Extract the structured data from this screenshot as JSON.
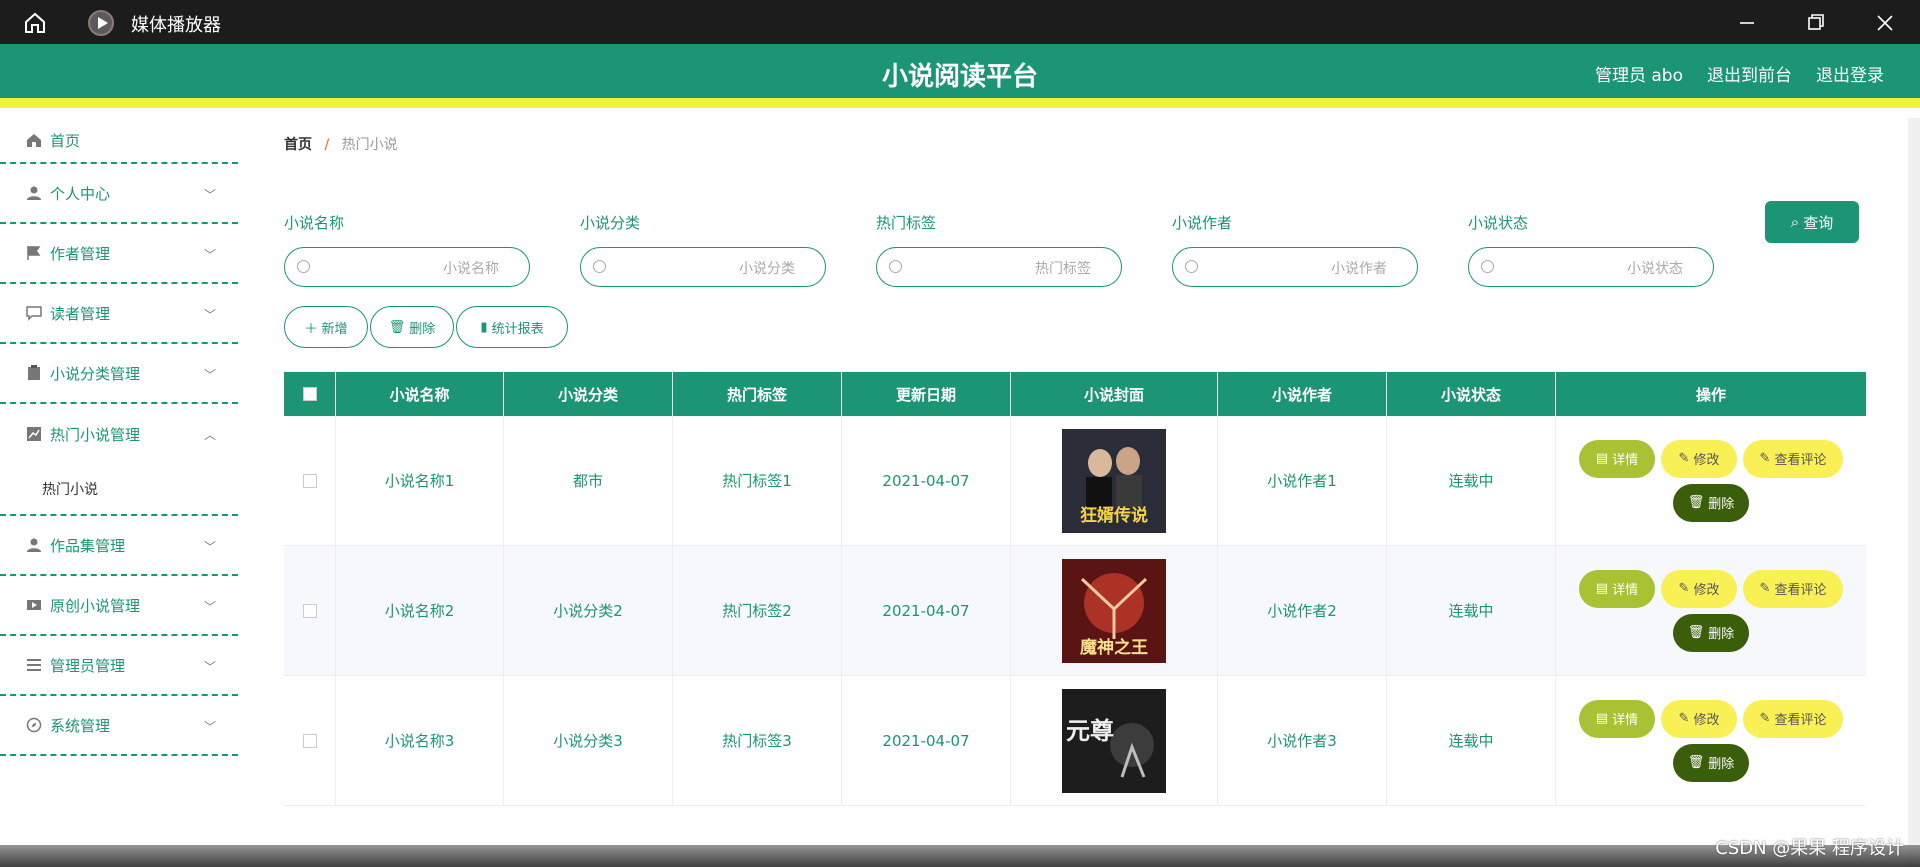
{
  "window": {
    "title": "媒体播放器"
  },
  "header": {
    "title": "小说阅读平台",
    "admin": "管理员 abo",
    "to_front": "退出到前台",
    "logout": "退出登录"
  },
  "sidebar": {
    "home": "首页",
    "items": [
      {
        "label": "个人中心",
        "icon": "user-icon"
      },
      {
        "label": "作者管理",
        "icon": "flag-icon"
      },
      {
        "label": "读者管理",
        "icon": "chat-icon"
      },
      {
        "label": "小说分类管理",
        "icon": "clipboard-icon"
      },
      {
        "label": "热门小说管理",
        "icon": "chart-icon",
        "expanded": true,
        "sub": "热门小说"
      },
      {
        "label": "作品集管理",
        "icon": "user-icon"
      },
      {
        "label": "原创小说管理",
        "icon": "video-icon"
      },
      {
        "label": "管理员管理",
        "icon": "list-icon"
      },
      {
        "label": "系统管理",
        "icon": "compass-icon"
      }
    ]
  },
  "breadcrumb": {
    "home": "首页",
    "separator": "/",
    "current": "热门小说"
  },
  "filters": [
    {
      "label": "小说名称",
      "placeholder": "小说名称"
    },
    {
      "label": "小说分类",
      "placeholder": "小说分类"
    },
    {
      "label": "热门标签",
      "placeholder": "热门标签"
    },
    {
      "label": "小说作者",
      "placeholder": "小说作者"
    },
    {
      "label": "小说状态",
      "placeholder": "小说状态"
    }
  ],
  "search_btn": "查询",
  "actions": {
    "add": "新增",
    "delete": "删除",
    "stats": "统计报表"
  },
  "table": {
    "headers": [
      "小说名称",
      "小说分类",
      "热门标签",
      "更新日期",
      "小说封面",
      "小说作者",
      "小说状态",
      "操作"
    ],
    "rows": [
      {
        "name": "小说名称1",
        "category": "都市",
        "tag": "热门标签1",
        "date": "2021-04-07",
        "author": "小说作者1",
        "status": "连载中",
        "cover_text": "狂婿传说"
      },
      {
        "name": "小说名称2",
        "category": "小说分类2",
        "tag": "热门标签2",
        "date": "2021-04-07",
        "author": "小说作者2",
        "status": "连载中",
        "cover_text": "魔神之王"
      },
      {
        "name": "小说名称3",
        "category": "小说分类3",
        "tag": "热门标签3",
        "date": "2021-04-07",
        "author": "小说作者3",
        "status": "连载中",
        "cover_text": "元尊"
      }
    ],
    "ops": {
      "detail": "详情",
      "edit": "修改",
      "comment": "查看评论",
      "del": "删除"
    }
  },
  "colors": {
    "primary": "#1c9574",
    "accent": "#f2f13c",
    "detail": "#a9c233",
    "edit": "#f9f056",
    "del": "#3a5e0a"
  },
  "watermark": "CSDN @果果 程序设计"
}
